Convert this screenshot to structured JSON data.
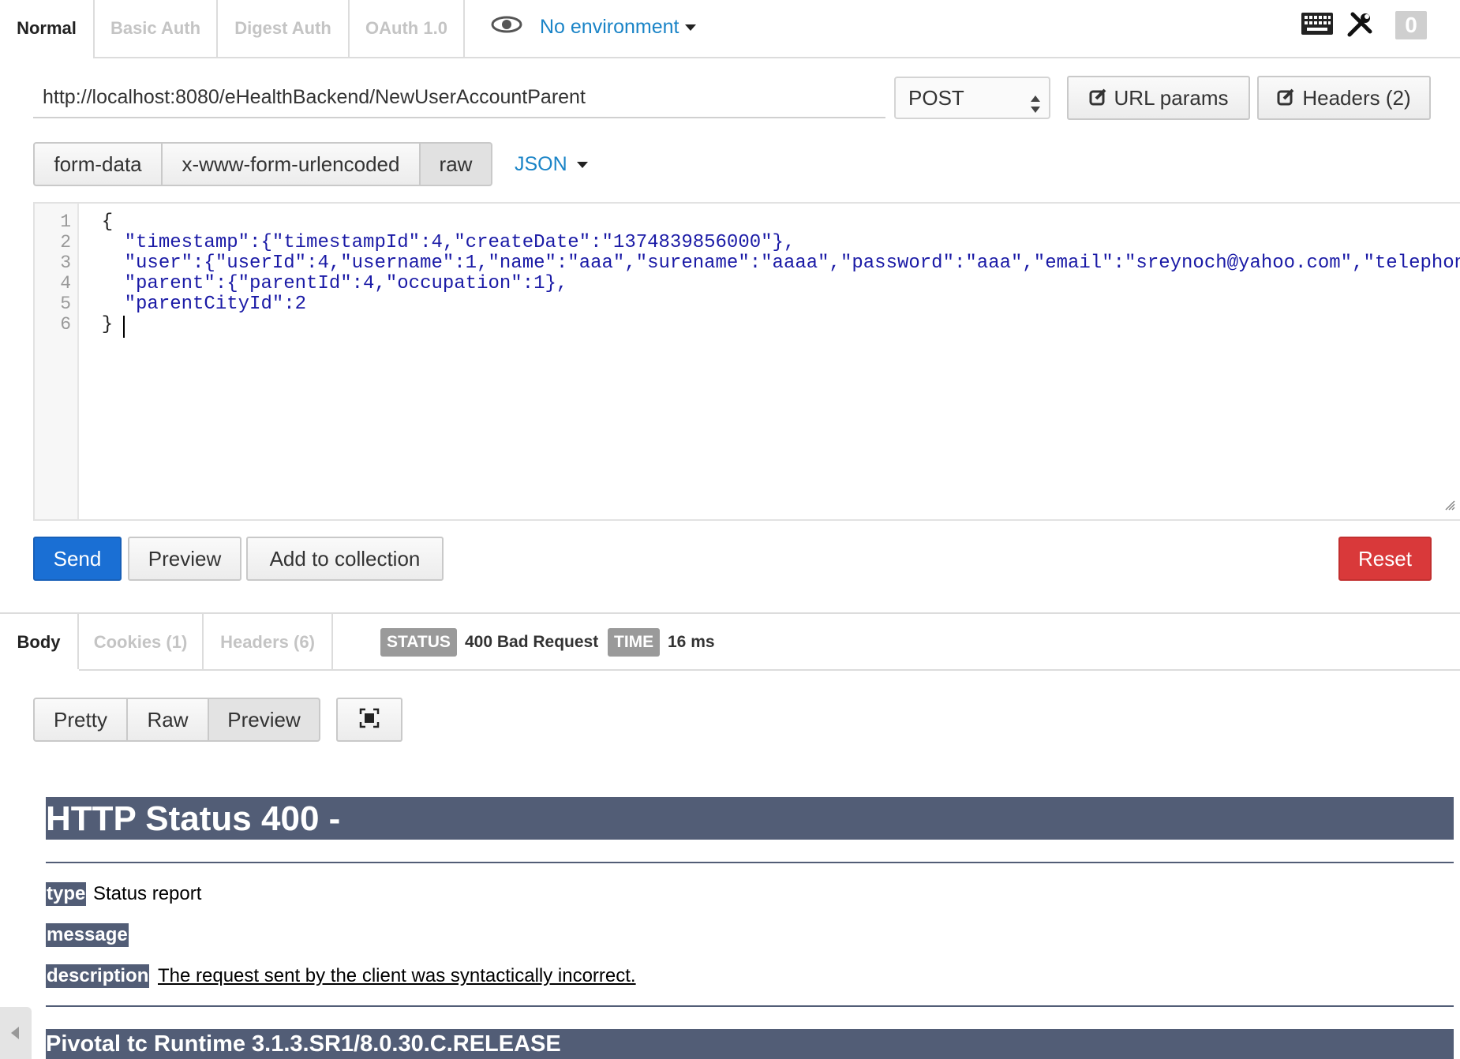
{
  "auth_tabs": [
    "Normal",
    "Basic Auth",
    "Digest Auth",
    "OAuth 1.0"
  ],
  "environment": {
    "label": "No environment"
  },
  "count_badge": "0",
  "request": {
    "url": "http://localhost:8080/eHealthBackend/NewUserAccountParent",
    "method": "POST",
    "url_params_label": "URL params",
    "headers_label": "Headers (2)"
  },
  "body_modes": [
    "form-data",
    "x-www-form-urlencoded",
    "raw"
  ],
  "body_mode_selected": "raw",
  "content_type": "JSON",
  "editor": {
    "line_numbers": [
      "1",
      "2",
      "3",
      "4",
      "5",
      "6"
    ],
    "lines": [
      "  {",
      "    \"timestamp\":{\"timestampId\":4,\"createDate\":\"1374839856000\"},",
      "    \"user\":{\"userId\":4,\"username\":1,\"name\":\"aaa\",\"surename\":\"aaaa\",\"password\":\"aaa\",\"email\":\"sreynoch@yahoo.com\",\"telephon",
      "    \"parent\":{\"parentId\":4,\"occupation\":1},",
      "    \"parentCityId\":2",
      "  }"
    ]
  },
  "actions": {
    "send": "Send",
    "preview": "Preview",
    "add_to_collection": "Add to collection",
    "reset": "Reset"
  },
  "response_tabs": [
    "Body",
    "Cookies (1)",
    "Headers (6)"
  ],
  "status": {
    "label": "STATUS",
    "value": "400 Bad Request"
  },
  "time": {
    "label": "TIME",
    "value": "16 ms"
  },
  "view_modes": [
    "Pretty",
    "Raw",
    "Preview"
  ],
  "view_mode_selected": "Preview",
  "preview_html": {
    "title": "HTTP Status 400 -",
    "type_label": "type",
    "type_value": "Status report",
    "message_label": "message",
    "description_label": "description",
    "description_value": "The request sent by the client was syntactically incorrect.",
    "footer": "Pivotal tc Runtime 3.1.3.SR1/8.0.30.C.RELEASE"
  },
  "colors": {
    "accent_blue": "#1a84c7",
    "send_button": "#1a6fd4",
    "reset_button": "#d9393a",
    "tomcat_bar": "#525d76",
    "json_key": "#1a1aa6",
    "json_number": "#116644"
  },
  "icons": [
    "eye-icon",
    "chevron-down-icon",
    "keyboard-icon",
    "tools-icon",
    "edit-icon",
    "expand-icon",
    "collapse-arrow-icon",
    "resize-grip-icon"
  ]
}
